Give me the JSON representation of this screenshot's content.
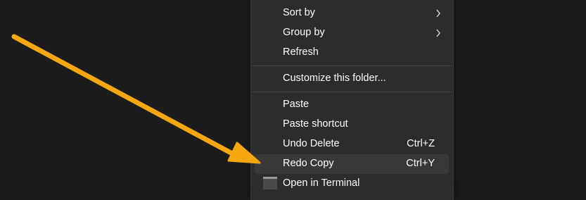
{
  "menu": {
    "items": [
      {
        "label": "Sort by",
        "submenu": true
      },
      {
        "label": "Group by",
        "submenu": true
      },
      {
        "label": "Refresh"
      },
      {
        "label": "Customize this folder..."
      },
      {
        "label": "Paste"
      },
      {
        "label": "Paste shortcut"
      },
      {
        "label": "Undo Delete",
        "shortcut": "Ctrl+Z"
      },
      {
        "label": "Redo Copy",
        "shortcut": "Ctrl+Y",
        "highlighted": true
      },
      {
        "label": "Open in Terminal"
      }
    ]
  },
  "annotation": {
    "arrow_color": "#f5a70f"
  },
  "colors": {
    "background": "#1c1c1c",
    "menu_background": "#2c2c2c",
    "highlight": "#383838",
    "text": "#ffffff"
  }
}
